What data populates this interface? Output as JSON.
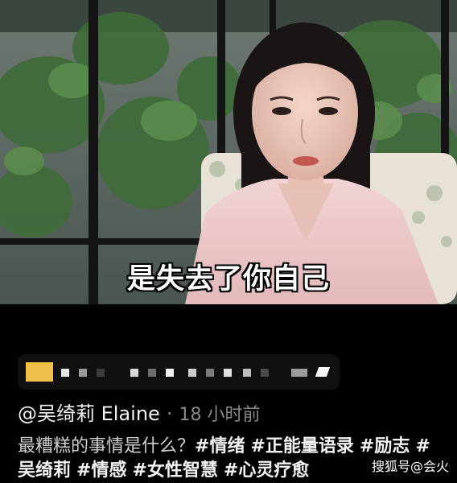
{
  "video": {
    "subtitle": "是失去了你自己"
  },
  "post": {
    "author": "@吴绮莉 Elaine",
    "separator": "·",
    "time": "18 小时前",
    "question": "最糟糕的事情是什么？",
    "hashtags": [
      "#情绪",
      "#正能量语录",
      "#励志",
      "#吴绮莉",
      "#情感",
      "#女性智慧",
      "#心灵疗愈"
    ]
  },
  "watermark": "搜狐号@会火",
  "icons": {
    "mosaic": "blurred-link-bar"
  },
  "colors": {
    "background": "#000000",
    "text": "#d8d8d8",
    "muted": "#8a8a8a",
    "mosaic_accent": "#f0c24a"
  }
}
